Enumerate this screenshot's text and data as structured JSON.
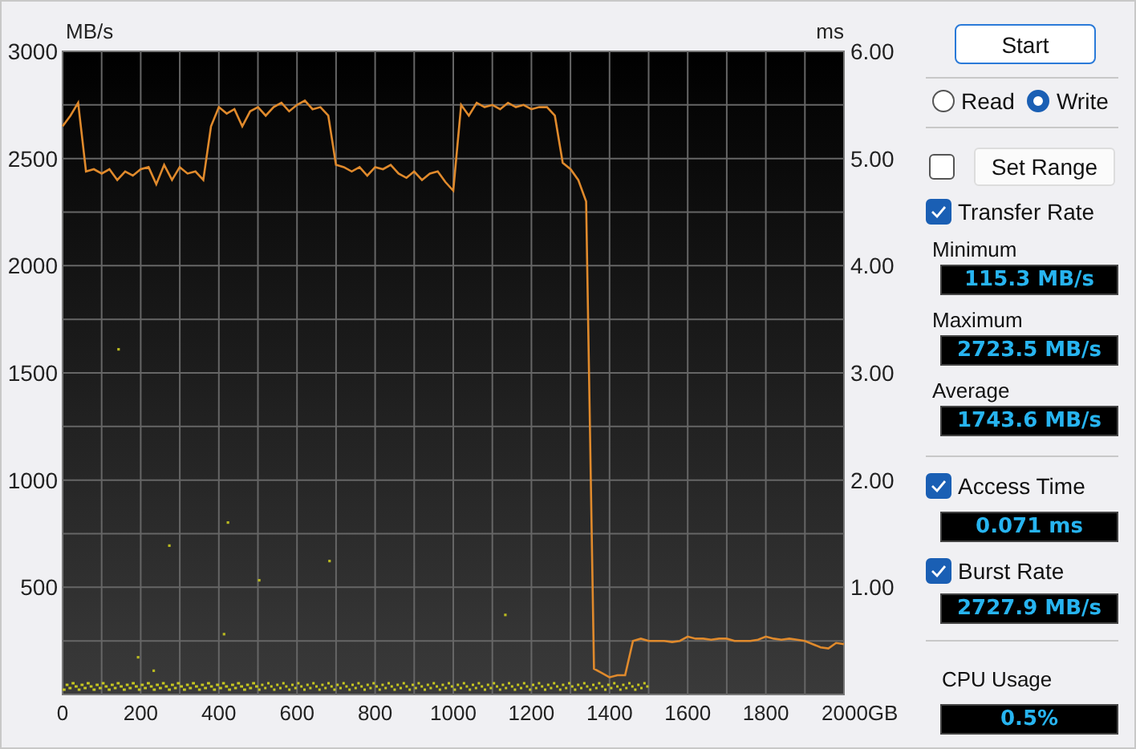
{
  "chart": {
    "right_axis": {
      "unit": "ms",
      "labels": [
        "6.00",
        "5.00",
        "4.00",
        "3.00",
        "2.00",
        "1.00"
      ]
    },
    "chart_data": {
      "type": "line",
      "ylabel": "MB/s",
      "grid": true,
      "xlim": [
        0,
        2000
      ],
      "ylim": [
        0,
        3000
      ],
      "xticks": [
        0,
        200,
        400,
        600,
        800,
        1000,
        1200,
        1400,
        1600,
        1800,
        {
          "value": 2000,
          "label": "2000GB"
        }
      ],
      "yticks": [
        500,
        1000,
        1500,
        2000,
        2500,
        3000
      ],
      "x": [
        0,
        20,
        40,
        60,
        80,
        100,
        120,
        140,
        160,
        180,
        200,
        220,
        240,
        260,
        280,
        300,
        320,
        340,
        360,
        380,
        400,
        420,
        440,
        460,
        480,
        500,
        520,
        540,
        560,
        580,
        600,
        620,
        640,
        660,
        680,
        700,
        720,
        740,
        760,
        780,
        800,
        820,
        840,
        860,
        880,
        900,
        920,
        940,
        960,
        980,
        1000,
        1020,
        1040,
        1060,
        1080,
        1100,
        1120,
        1140,
        1160,
        1180,
        1200,
        1220,
        1240,
        1260,
        1280,
        1300,
        1320,
        1340,
        1360,
        1380,
        1400,
        1420,
        1440,
        1460,
        1480,
        1500,
        1520,
        1540,
        1560,
        1580,
        1600,
        1620,
        1640,
        1660,
        1680,
        1700,
        1720,
        1740,
        1760,
        1780,
        1800,
        1820,
        1840,
        1860,
        1880,
        1900,
        1920,
        1940,
        1960,
        1980,
        2000
      ],
      "series": [
        {
          "color": "#e08a2c",
          "values": [
            2650,
            2700,
            2760,
            2440,
            2450,
            2430,
            2450,
            2400,
            2440,
            2420,
            2450,
            2460,
            2380,
            2470,
            2400,
            2460,
            2430,
            2440,
            2400,
            2650,
            2740,
            2710,
            2730,
            2650,
            2720,
            2740,
            2700,
            2740,
            2760,
            2720,
            2750,
            2770,
            2730,
            2740,
            2700,
            2470,
            2460,
            2440,
            2460,
            2420,
            2460,
            2450,
            2470,
            2430,
            2410,
            2440,
            2400,
            2430,
            2440,
            2390,
            2350,
            2750,
            2700,
            2760,
            2740,
            2750,
            2730,
            2760,
            2740,
            2750,
            2730,
            2740,
            2740,
            2700,
            2480,
            2450,
            2400,
            2300,
            120,
            100,
            80,
            90,
            90,
            250,
            260,
            250,
            250,
            250,
            245,
            250,
            270,
            260,
            260,
            255,
            260,
            260,
            250,
            250,
            250,
            255,
            270,
            260,
            255,
            260,
            255,
            250,
            235,
            220,
            215,
            240,
            235
          ]
        }
      ]
    }
  },
  "panel": {
    "start_button": "Start",
    "modes": [
      {
        "label": "Read",
        "selected": false
      },
      {
        "label": "Write",
        "selected": true
      }
    ],
    "set_range": {
      "checked": false,
      "label": "Set Range"
    },
    "transfer_rate": {
      "label": "Transfer Rate",
      "checked": true,
      "stats": [
        {
          "label": "Minimum",
          "value": "115.3 MB/s"
        },
        {
          "label": "Maximum",
          "value": "2723.5 MB/s"
        },
        {
          "label": "Average",
          "value": "1743.6 MB/s"
        }
      ]
    },
    "access_time": {
      "label": "Access Time",
      "checked": true,
      "value": "0.071 ms"
    },
    "burst_rate": {
      "label": "Burst Rate",
      "checked": true,
      "value": "2727.9 MB/s"
    },
    "cpu_usage": {
      "label": "CPU Usage",
      "value": "0.5%"
    }
  }
}
